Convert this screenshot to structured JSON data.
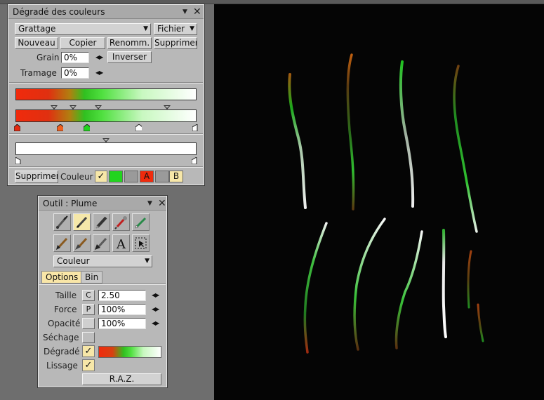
{
  "gradient_panel": {
    "title": "Dégradé des couleurs",
    "preset_select": "Grattage",
    "file_menu": "Fichier",
    "buttons": {
      "new": "Nouveau",
      "copy": "Copier",
      "rename": "Renomm.",
      "delete": "Supprimer",
      "invert": "Inverser"
    },
    "grain_label": "Grain",
    "grain_value": "0%",
    "halftone_label": "Tramage",
    "halftone_value": "0%",
    "bottom": {
      "delete": "Supprimer",
      "color_label": "Couleur",
      "a_label": "A",
      "b_label": "B"
    },
    "colors": {
      "red": "#f02a0c",
      "orange": "#e07010",
      "green": "#22d41e",
      "light_green": "#c8f8c0",
      "white": "#ffffff"
    }
  },
  "tool_panel": {
    "title": "Outil : Plume",
    "tools": [
      "brush-icon",
      "pen-icon",
      "marker-icon",
      "airbrush-icon",
      "pencil-icon",
      "wide-brush-icon",
      "fan-brush-icon",
      "knife-brush-icon",
      "text-icon",
      "selection-icon"
    ],
    "mode_select": "Couleur",
    "tabs": {
      "options": "Options",
      "bin": "Bin"
    },
    "rows": {
      "size_label": "Taille",
      "size_btn": "C",
      "size_value": "2.50",
      "force_label": "Force",
      "force_btn": "P",
      "force_value": "100%",
      "opacity_label": "Opacité",
      "opacity_value": "100%",
      "drying_label": "Séchage",
      "gradient_label": "Dégradé",
      "smoothing_label": "Lissage"
    },
    "reset": "R.A.Z."
  }
}
